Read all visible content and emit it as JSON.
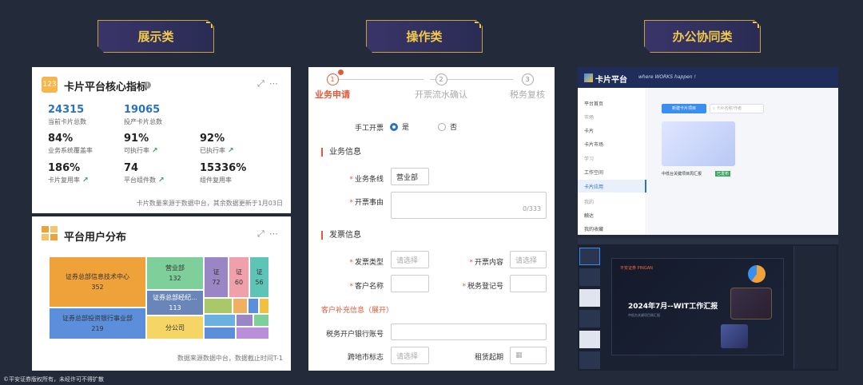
{
  "tags": [
    "展示类",
    "操作类",
    "办公协同类"
  ],
  "footer": "©平安证券版权所有，未经许可不得扩散",
  "display": {
    "card1": {
      "icon_text": "123",
      "title": "卡片平台核心指标",
      "stats": [
        {
          "value": "24315",
          "label": "当前卡片总数"
        },
        {
          "value": "19065",
          "label": "投产卡片总数"
        },
        {
          "value": "84%",
          "label": "业务系统覆盖率"
        },
        {
          "value": "91%",
          "label": "可执行率"
        },
        {
          "value": "92%",
          "label": "已执行率"
        },
        {
          "value": "186%",
          "label": "卡片复用率"
        },
        {
          "value": "74",
          "label": "平台组件数"
        },
        {
          "value": "15336%",
          "label": "组件复用率"
        }
      ],
      "note": "卡片数量来源于数据中台，其余数据更新于1月03日"
    },
    "card2": {
      "title": "平台用户分布",
      "tiles": [
        {
          "name": "证券总部信息技术中心",
          "value": "352",
          "color": "#f0a23a"
        },
        {
          "name": "证券总部投资银行事业部",
          "value": "219",
          "color": "#5b8fdc"
        },
        {
          "name": "营业部",
          "value": "132",
          "color": "#7fcf9a"
        },
        {
          "name": "证券总部经纪...",
          "value": "113",
          "color": "#6a86b8"
        },
        {
          "name": "分公司",
          "value": "",
          "color": "#f5d566"
        },
        {
          "name": "证",
          "value": "72",
          "color": "#9a86c4"
        },
        {
          "name": "证",
          "value": "60",
          "color": "#f0a0aa"
        },
        {
          "name": "证",
          "value": "56",
          "color": "#5ec4b8"
        }
      ],
      "note": "数据来源数据中台，数据截止时间T-1"
    }
  },
  "operation": {
    "steps": [
      {
        "num": "1",
        "label": "业务申请"
      },
      {
        "num": "2",
        "label": "开票流水确认"
      },
      {
        "num": "3",
        "label": "税务复核"
      }
    ],
    "manual_label": "手工开票",
    "radio_yes": "是",
    "radio_no": "否",
    "section_business": "业务信息",
    "biz_line_label": "业务条线",
    "biz_line_value": "营业部",
    "reason_label": "开票事由",
    "reason_counter": "0/333",
    "section_invoice": "发票信息",
    "invoice_type_label": "发票类型",
    "invoice_content_label": "开票内容",
    "customer_name_label": "客户名称",
    "tax_id_label": "税务登记号",
    "select_placeholder": "请选择",
    "expand_link": "客户补充信息（展开）",
    "bank_account_label": "税务开户银行账号",
    "cross_region_label": "跨地市标志",
    "lease_start_label": "租赁起期"
  },
  "office": {
    "app_title": "卡片平台",
    "app_slogan": "where WORKS happen !",
    "menu": [
      "平台首页",
      "市场",
      "卡片",
      "卡片市场",
      "学习",
      "工作空间",
      "卡片应用",
      "我的",
      "触达",
      "我的收藏"
    ],
    "new_button": "新建卡片项目",
    "search_placeholder": "卡片名称/作者",
    "project_name": "中低台关键项目周汇报",
    "project_status": "已发布",
    "slide_brand": "平安证券 PINGAN",
    "slide_title": "2024年7月--WIT工作汇报",
    "slide_subtitle": "中低台关键项目周汇报"
  }
}
